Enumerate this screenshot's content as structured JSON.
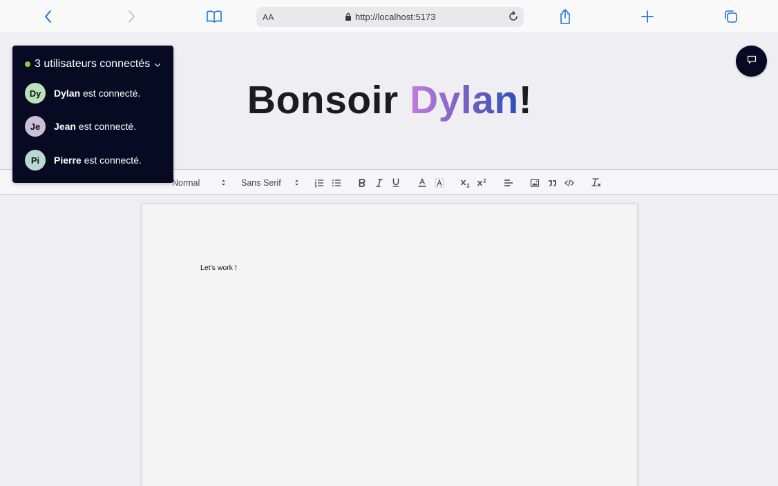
{
  "browser": {
    "aa_label": "AA",
    "url": "http://localhost:5173",
    "icons": [
      "back-icon",
      "forward-icon",
      "bookmarks-icon",
      "lock-icon",
      "reload-icon",
      "share-icon",
      "new-tab-icon",
      "tabs-icon"
    ]
  },
  "greeting": {
    "prefix": "Bonsoir ",
    "name": "Dylan",
    "suffix": "!"
  },
  "users_panel": {
    "status_color": "#8bd13b",
    "header": "3 utilisateurs connectés",
    "users": [
      {
        "initials": "Dy",
        "name": "Dylan",
        "status": " est connecté.",
        "avatar_color": "#b9e2bc"
      },
      {
        "initials": "Je",
        "name": "Jean",
        "status": " est connecté.",
        "avatar_color": "#cbbfd8"
      },
      {
        "initials": "Pi",
        "name": "Pierre",
        "status": " est connecté.",
        "avatar_color": "#b8d9cf"
      }
    ]
  },
  "toolbar": {
    "header_select": "Normal",
    "font_select": "Sans Serif",
    "buttons": [
      "ordered-list",
      "bullet-list",
      "bold",
      "italic",
      "underline",
      "text-color",
      "background-color",
      "subscript",
      "superscript",
      "align",
      "image",
      "blockquote",
      "code",
      "clean-format"
    ]
  },
  "document": {
    "text": "Let's work !"
  },
  "colors": {
    "panel_bg": "#080a24",
    "gradient_start": "#c27de0",
    "gradient_end": "#2c4fba"
  }
}
